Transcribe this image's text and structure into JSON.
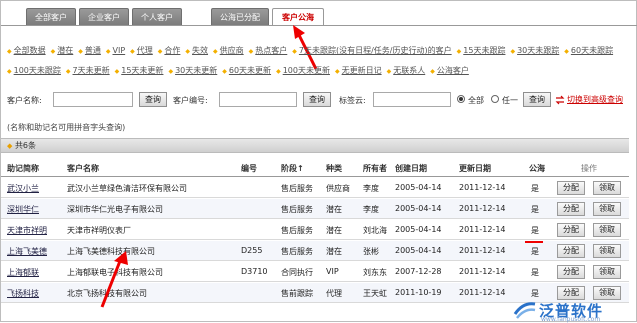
{
  "tabs": [
    "全部客户",
    "企业客户",
    "个人客户",
    "公海已分配",
    "客户公海"
  ],
  "filters": [
    "全部数据",
    "潜在",
    "普通",
    "VIP",
    "代理",
    "合作",
    "失效",
    "供应商",
    "热点客户",
    "7天未跟踪(没有日程/任务/历史行动)的客户",
    "15天未跟踪",
    "30天未跟踪",
    "60天未跟踪",
    "100天未跟踪",
    "7天未更新",
    "15天未更新",
    "30天未更新",
    "60天未更新",
    "100天未更新",
    "无更新日记",
    "无联系人",
    "公海客户"
  ],
  "search": {
    "name_label": "客户名称:",
    "query_button": "查询",
    "code_label": "客户编号:",
    "tag_label": "标签云:",
    "radio_all": "全部",
    "radio_any": "任一",
    "advanced_link": "切换到高级查询"
  },
  "hint": "(名称和助记名可用拼音字头查询)",
  "count_text": "共6条",
  "columns": [
    "助记简称",
    "客户名称",
    "编号",
    "阶段↑",
    "种类",
    "所有者",
    "创建日期",
    "更新日期",
    "公海",
    "操作"
  ],
  "action_labels": {
    "assign": "分配",
    "claim": "领取"
  },
  "rows": [
    {
      "short": "武汉小兰",
      "name": "武汉小兰草绿色清洁环保有限公司",
      "code": "",
      "stage": "售后服务",
      "kind": "供应商",
      "owner": "李度",
      "created": "2005-04-14",
      "updated": "2011-12-14",
      "public": "是"
    },
    {
      "short": "深圳华仁",
      "name": "深圳市华仁光电子有限公司",
      "code": "",
      "stage": "售后服务",
      "kind": "潜在",
      "owner": "李度",
      "created": "2005-04-14",
      "updated": "2011-12-14",
      "public": "是"
    },
    {
      "short": "天津市祥明",
      "name": "天津市祥明仪表厂",
      "code": "",
      "stage": "售后服务",
      "kind": "潜在",
      "owner": "刘北海",
      "created": "2005-04-14",
      "updated": "2011-12-14",
      "public": "是"
    },
    {
      "short": "上海飞美德",
      "name": "上海飞美德科技有限公司",
      "code": "D255",
      "stage": "售后服务",
      "kind": "潜在",
      "owner": "张彬",
      "created": "2005-04-14",
      "updated": "2011-12-14",
      "public": "是"
    },
    {
      "short": "上海郁联",
      "name": "上海郁联电子科技有限公司",
      "code": "D3710",
      "stage": "合同执行",
      "kind": "VIP",
      "owner": "刘东东",
      "created": "2007-12-28",
      "updated": "2011-12-14",
      "public": "是"
    },
    {
      "short": "飞扬科技",
      "name": "北京飞扬科技有限公司",
      "code": "",
      "stage": "售前跟踪",
      "kind": "代理",
      "owner": "王天虹",
      "created": "2011-10-19",
      "updated": "2011-12-14",
      "public": "是"
    }
  ],
  "logo": {
    "text": "泛普软件",
    "url": "www.fanpusoft.com"
  },
  "colors": {
    "accent_red": "#e00000",
    "header_blue": "#3a78c4",
    "tab_gray": "#888888",
    "filter_diamond": "#f3b000"
  }
}
